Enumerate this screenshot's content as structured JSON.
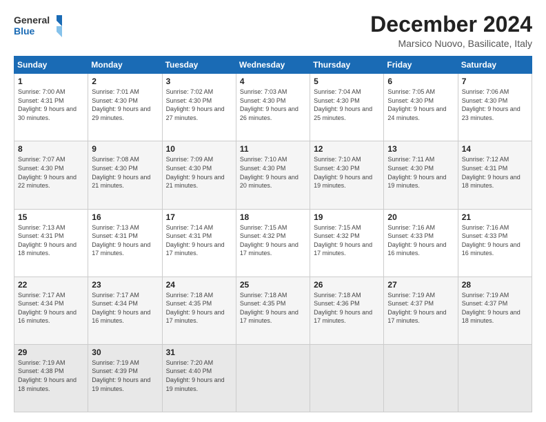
{
  "header": {
    "logo_line1": "General",
    "logo_line2": "Blue",
    "title": "December 2024",
    "subtitle": "Marsico Nuovo, Basilicate, Italy"
  },
  "days_of_week": [
    "Sunday",
    "Monday",
    "Tuesday",
    "Wednesday",
    "Thursday",
    "Friday",
    "Saturday"
  ],
  "weeks": [
    [
      {
        "day": "1",
        "sunrise": "7:00 AM",
        "sunset": "4:31 PM",
        "daylight": "9 hours and 30 minutes."
      },
      {
        "day": "2",
        "sunrise": "7:01 AM",
        "sunset": "4:30 PM",
        "daylight": "9 hours and 29 minutes."
      },
      {
        "day": "3",
        "sunrise": "7:02 AM",
        "sunset": "4:30 PM",
        "daylight": "9 hours and 27 minutes."
      },
      {
        "day": "4",
        "sunrise": "7:03 AM",
        "sunset": "4:30 PM",
        "daylight": "9 hours and 26 minutes."
      },
      {
        "day": "5",
        "sunrise": "7:04 AM",
        "sunset": "4:30 PM",
        "daylight": "9 hours and 25 minutes."
      },
      {
        "day": "6",
        "sunrise": "7:05 AM",
        "sunset": "4:30 PM",
        "daylight": "9 hours and 24 minutes."
      },
      {
        "day": "7",
        "sunrise": "7:06 AM",
        "sunset": "4:30 PM",
        "daylight": "9 hours and 23 minutes."
      }
    ],
    [
      {
        "day": "8",
        "sunrise": "7:07 AM",
        "sunset": "4:30 PM",
        "daylight": "9 hours and 22 minutes."
      },
      {
        "day": "9",
        "sunrise": "7:08 AM",
        "sunset": "4:30 PM",
        "daylight": "9 hours and 21 minutes."
      },
      {
        "day": "10",
        "sunrise": "7:09 AM",
        "sunset": "4:30 PM",
        "daylight": "9 hours and 21 minutes."
      },
      {
        "day": "11",
        "sunrise": "7:10 AM",
        "sunset": "4:30 PM",
        "daylight": "9 hours and 20 minutes."
      },
      {
        "day": "12",
        "sunrise": "7:10 AM",
        "sunset": "4:30 PM",
        "daylight": "9 hours and 19 minutes."
      },
      {
        "day": "13",
        "sunrise": "7:11 AM",
        "sunset": "4:30 PM",
        "daylight": "9 hours and 19 minutes."
      },
      {
        "day": "14",
        "sunrise": "7:12 AM",
        "sunset": "4:31 PM",
        "daylight": "9 hours and 18 minutes."
      }
    ],
    [
      {
        "day": "15",
        "sunrise": "7:13 AM",
        "sunset": "4:31 PM",
        "daylight": "9 hours and 18 minutes."
      },
      {
        "day": "16",
        "sunrise": "7:13 AM",
        "sunset": "4:31 PM",
        "daylight": "9 hours and 17 minutes."
      },
      {
        "day": "17",
        "sunrise": "7:14 AM",
        "sunset": "4:31 PM",
        "daylight": "9 hours and 17 minutes."
      },
      {
        "day": "18",
        "sunrise": "7:15 AM",
        "sunset": "4:32 PM",
        "daylight": "9 hours and 17 minutes."
      },
      {
        "day": "19",
        "sunrise": "7:15 AM",
        "sunset": "4:32 PM",
        "daylight": "9 hours and 17 minutes."
      },
      {
        "day": "20",
        "sunrise": "7:16 AM",
        "sunset": "4:33 PM",
        "daylight": "9 hours and 16 minutes."
      },
      {
        "day": "21",
        "sunrise": "7:16 AM",
        "sunset": "4:33 PM",
        "daylight": "9 hours and 16 minutes."
      }
    ],
    [
      {
        "day": "22",
        "sunrise": "7:17 AM",
        "sunset": "4:34 PM",
        "daylight": "9 hours and 16 minutes."
      },
      {
        "day": "23",
        "sunrise": "7:17 AM",
        "sunset": "4:34 PM",
        "daylight": "9 hours and 16 minutes."
      },
      {
        "day": "24",
        "sunrise": "7:18 AM",
        "sunset": "4:35 PM",
        "daylight": "9 hours and 17 minutes."
      },
      {
        "day": "25",
        "sunrise": "7:18 AM",
        "sunset": "4:35 PM",
        "daylight": "9 hours and 17 minutes."
      },
      {
        "day": "26",
        "sunrise": "7:18 AM",
        "sunset": "4:36 PM",
        "daylight": "9 hours and 17 minutes."
      },
      {
        "day": "27",
        "sunrise": "7:19 AM",
        "sunset": "4:37 PM",
        "daylight": "9 hours and 17 minutes."
      },
      {
        "day": "28",
        "sunrise": "7:19 AM",
        "sunset": "4:37 PM",
        "daylight": "9 hours and 18 minutes."
      }
    ],
    [
      {
        "day": "29",
        "sunrise": "7:19 AM",
        "sunset": "4:38 PM",
        "daylight": "9 hours and 18 minutes."
      },
      {
        "day": "30",
        "sunrise": "7:19 AM",
        "sunset": "4:39 PM",
        "daylight": "9 hours and 19 minutes."
      },
      {
        "day": "31",
        "sunrise": "7:20 AM",
        "sunset": "4:40 PM",
        "daylight": "9 hours and 19 minutes."
      },
      null,
      null,
      null,
      null
    ]
  ]
}
